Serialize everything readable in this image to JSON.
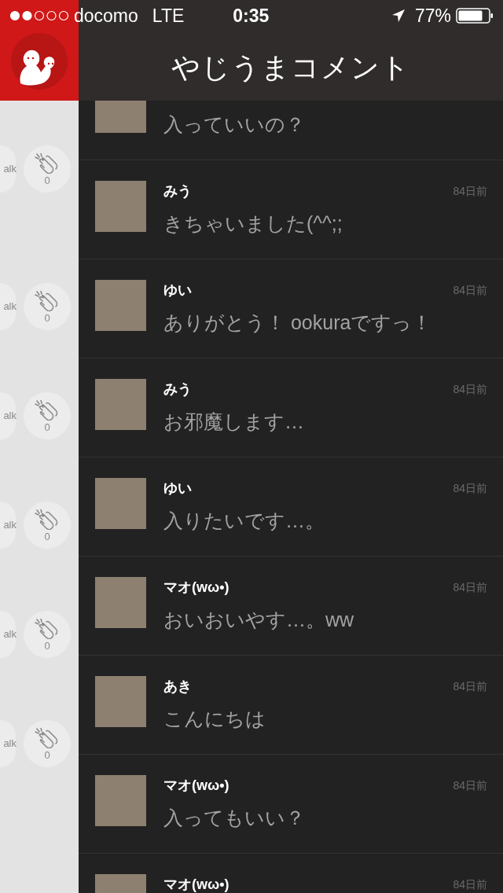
{
  "status_bar": {
    "carrier": "docomo",
    "network": "LTE",
    "time": "0:35",
    "battery": "77%"
  },
  "header": {
    "title": "やじうまコメント"
  },
  "side_actions": [
    {
      "talk_label": "alk",
      "count": "0"
    },
    {
      "talk_label": "alk",
      "count": "0"
    },
    {
      "talk_label": "alk",
      "count": "0"
    },
    {
      "talk_label": "alk",
      "count": "0"
    },
    {
      "talk_label": "alk",
      "count": "0"
    },
    {
      "talk_label": "alk",
      "count": "0"
    }
  ],
  "comments": [
    {
      "message": "入っていいの？"
    },
    {
      "name": "みう",
      "time": "84日前",
      "message": "きちゃいました(^^;;"
    },
    {
      "name": "ゆい",
      "time": "84日前",
      "message": "ありがとう！ ookuraですっ！"
    },
    {
      "name": "みう",
      "time": "84日前",
      "message": "お邪魔します…"
    },
    {
      "name": "ゆい",
      "time": "84日前",
      "message": "入りたいです…。"
    },
    {
      "name": "マオ(wω•)",
      "time": "84日前",
      "message": "おいおいやす…。ww"
    },
    {
      "name": "あき",
      "time": "84日前",
      "message": "こんにちは"
    },
    {
      "name": "マオ(wω•)",
      "time": "84日前",
      "message": "入ってもいい？"
    },
    {
      "name": "マオ(wω•)",
      "time": "84日前"
    }
  ]
}
